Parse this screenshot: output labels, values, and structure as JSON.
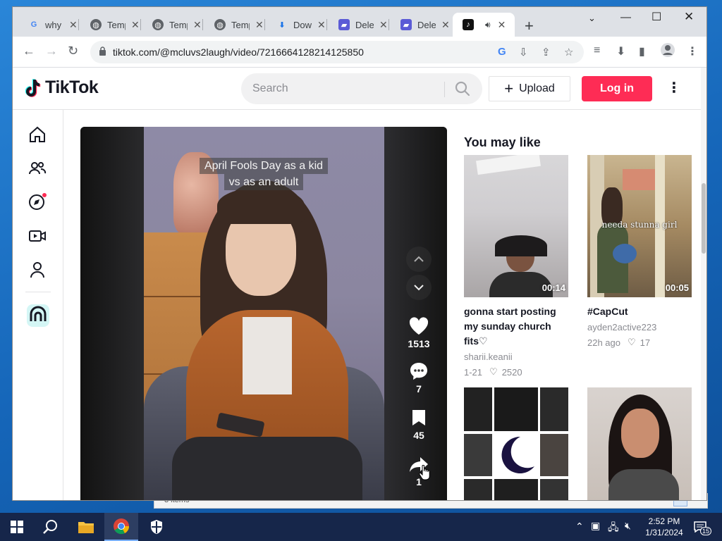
{
  "browser": {
    "tabs": [
      {
        "label": "why",
        "favicon": "google-icon"
      },
      {
        "label": "Temp",
        "favicon": "globe-icon"
      },
      {
        "label": "Temp",
        "favicon": "globe-icon"
      },
      {
        "label": "Temp",
        "favicon": "globe-icon"
      },
      {
        "label": "Dow",
        "favicon": "download-icon"
      },
      {
        "label": "Dele",
        "favicon": "doc-icon"
      },
      {
        "label": "Dele",
        "favicon": "doc-icon"
      },
      {
        "label": "",
        "favicon": "tiktok-icon",
        "active": true
      }
    ],
    "url": "tiktok.com/@mcluvs2laugh/video/7216664128214125850"
  },
  "tiktok": {
    "logo_text": "TikTok",
    "search_placeholder": "Search",
    "upload_label": "Upload",
    "login_label": "Log in",
    "brand_color": "#fe2c55"
  },
  "video": {
    "caption_line1": "April Fools Day as a kid",
    "caption_line2": "vs as an adult",
    "likes": "1513",
    "comments": "7",
    "saves": "45",
    "shares": "1"
  },
  "suggestions": {
    "title": "You may like",
    "items": [
      {
        "title": "gonna start posting my sunday church fits♡",
        "author": "sharii.keanii",
        "date": "1-21",
        "likes": "2520",
        "duration": "00:14"
      },
      {
        "title": "#CapCut",
        "author": "ayden2active223",
        "date": "22h ago",
        "likes": "17",
        "duration": "00:05",
        "overlay": "needa stunna girl"
      }
    ]
  },
  "behind_window": {
    "status": "3 items"
  },
  "taskbar": {
    "time": "2:52 PM",
    "date": "1/31/2024",
    "notif_count": "15"
  }
}
